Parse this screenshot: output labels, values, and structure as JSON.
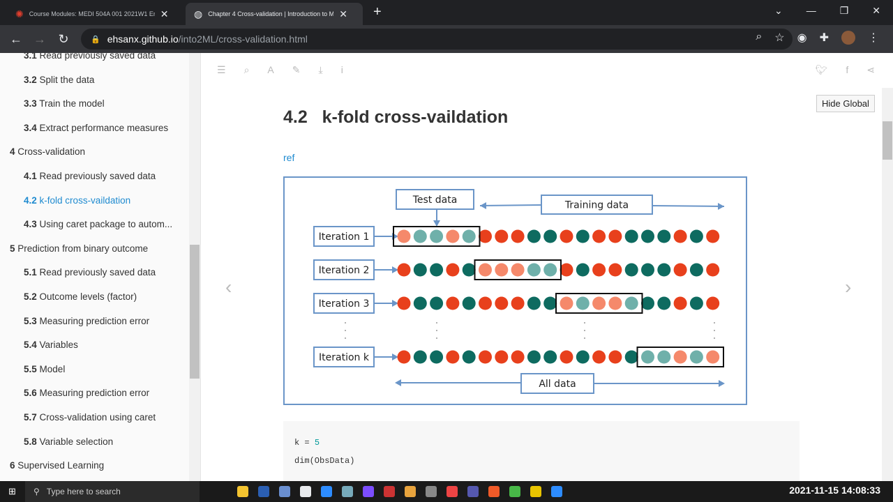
{
  "browser": {
    "tabs": [
      {
        "title": "Course Modules: MEDI 504A 001 2021W1 Emergi"
      },
      {
        "title": "Chapter 4 Cross-validation | Introduction to Mach"
      }
    ],
    "url_host": "ehsanx.github.io",
    "url_path": "/into2ML/cross-validation.html"
  },
  "sidebar": {
    "items": [
      {
        "num": "3.1",
        "label": "Read previously saved data",
        "level": 2
      },
      {
        "num": "3.2",
        "label": "Split the data",
        "level": 2
      },
      {
        "num": "3.3",
        "label": "Train the model",
        "level": 2
      },
      {
        "num": "3.4",
        "label": "Extract performance measures",
        "level": 2
      },
      {
        "num": "4",
        "label": "Cross-validation",
        "level": 1
      },
      {
        "num": "4.1",
        "label": "Read previously saved data",
        "level": 2
      },
      {
        "num": "4.2",
        "label": "k-fold cross-vaildation",
        "level": 2,
        "active": true
      },
      {
        "num": "4.3",
        "label": "Using caret package to autom...",
        "level": 2
      },
      {
        "num": "5",
        "label": "Prediction from binary outcome",
        "level": 1
      },
      {
        "num": "5.1",
        "label": "Read previously saved data",
        "level": 2
      },
      {
        "num": "5.2",
        "label": "Outcome levels (factor)",
        "level": 2
      },
      {
        "num": "5.3",
        "label": "Measuring prediction error",
        "level": 2
      },
      {
        "num": "5.4",
        "label": "Variables",
        "level": 2
      },
      {
        "num": "5.5",
        "label": "Model",
        "level": 2
      },
      {
        "num": "5.6",
        "label": "Measuring prediction error",
        "level": 2
      },
      {
        "num": "5.7",
        "label": "Cross-validation using caret",
        "level": 2
      },
      {
        "num": "5.8",
        "label": "Variable selection",
        "level": 2
      },
      {
        "num": "6",
        "label": "Supervised Learning",
        "level": 1
      }
    ]
  },
  "main": {
    "hide_button": "Hide Global",
    "section_num": "4.2",
    "section_title": "k-fold cross-vaildation",
    "ref_link": "ref",
    "code_lines": [
      [
        "k = ",
        "5"
      ],
      [
        "dim(ObsData)",
        ""
      ]
    ]
  },
  "figure": {
    "test_label": "Test data",
    "training_label": "Training data",
    "all_label": "All data",
    "iterations": [
      {
        "label": "Iteration 1",
        "test_start": 0
      },
      {
        "label": "Iteration 2",
        "test_start": 5
      },
      {
        "label": "Iteration 3",
        "test_start": 10
      },
      {
        "label": "Iteration k",
        "test_start": 15
      }
    ],
    "sequence": "RTTRTRRRTTRTRRTTTRTR",
    "colors": {
      "red": "#e8401c",
      "teal": "#0e6b60",
      "light_red": "#f5896b",
      "light_teal": "#6fb0aa",
      "frame": "#6a95c8"
    }
  },
  "taskbar": {
    "search_placeholder": "Type here to search",
    "clock": "2021-11-15  14:08:33"
  }
}
